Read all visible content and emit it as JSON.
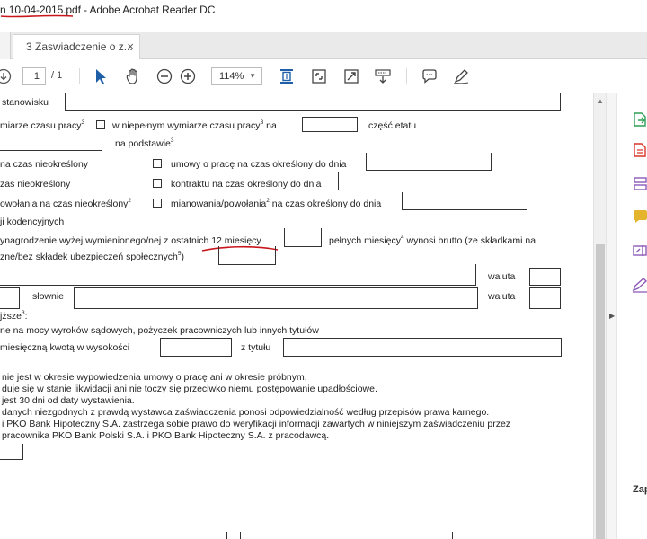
{
  "window": {
    "title": "n 10-04-2015.pdf - Adobe Acrobat Reader DC"
  },
  "tabs": [
    {
      "label": "3 Zaswiadczenie o z...",
      "close": "×"
    }
  ],
  "toolbar": {
    "page_current": "1",
    "page_total": "/ 1",
    "zoom": "114%"
  },
  "document": {
    "line1": "stanowisku",
    "line2_a": "miarze czasu pracy",
    "line2_b": "w niepełnym wymiarze czasu pracy",
    "line2_c": "na",
    "line2_d": "część etatu",
    "line3": "na podstawie",
    "line4_a": "na czas nieokreślony",
    "line4_b": "umowy o pracę na czas określony do dnia",
    "line5_a": "zas nieokreślony",
    "line5_b": "kontraktu na czas określony do dnia",
    "line6_a": "owołania na czas nieokreślony",
    "line6_b": "mianowania/powołania",
    "line6_c": "na czas określony do dnia",
    "line7": "ji kodencyjnych",
    "line8_a": "ynagrodzenie wyżej wymienionego/nej z ostatnich 12 miesięcy",
    "line8_b": "pełnych miesięcy",
    "line8_c": "wynosi brutto (ze składkami na",
    "line9": "zne/bez składek ubezpieczeń społecznych",
    "waluta1": "waluta",
    "slownie": "słownie",
    "waluta2": "waluta",
    "line12": "jższe",
    "line13": "ne na mocy wyroków sądowych, pożyczek pracowniczych lub innych tytułów",
    "line14_a": "miesięczną kwotą w wysokości",
    "line14_b": "z tytułu",
    "p1": "nie jest w okresie wypowiedzenia umowy o pracę ani w okresie próbnym.",
    "p2": "duje się w stanie likwidacji ani nie toczy się przeciwko niemu postępowanie upadłościowe.",
    "p3": "jest 30 dni od daty wystawienia.",
    "p4": "danych niezgodnych z prawdą wystawca zaświadczenia ponosi odpowiedzialność według przepisów prawa karnego.",
    "p5": "i PKO Bank Hipoteczny S.A. zastrzega sobie prawo do weryfikacji informacji zawartych w niniejszym zaświadczeniu przez",
    "p6": "pracownika  PKO Bank Polski S.A. i PKO Bank Hipoteczny S.A. z pracodawcą."
  },
  "footnotes": {
    "sup3": "3",
    "sup2": "2",
    "sup4": "4",
    "sup5": "5"
  },
  "right_panel": {
    "label": "Zap"
  },
  "colors": {
    "annotation_red": "#c8161d",
    "tool_blue": "#1f5fa8",
    "panel_green": "#2e9f55",
    "panel_red": "#d9362a",
    "panel_purple": "#8c5ab9",
    "panel_yellow": "#e4b52c"
  }
}
